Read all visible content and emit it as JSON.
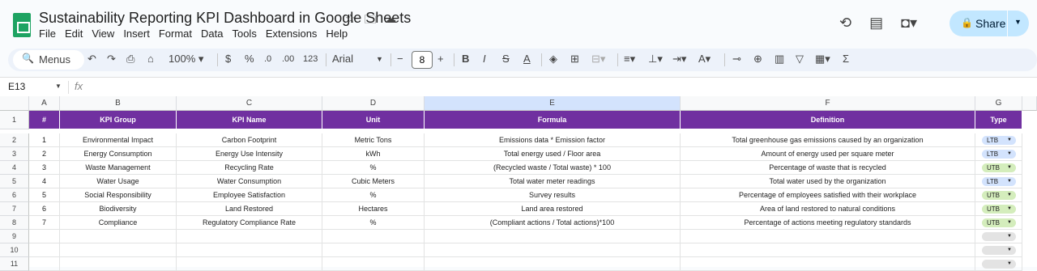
{
  "app": {
    "title": "Sustainability Reporting KPI Dashboard in Google Sheets",
    "menu": [
      "File",
      "Edit",
      "View",
      "Insert",
      "Format",
      "Data",
      "Tools",
      "Extensions",
      "Help"
    ],
    "share_label": "Share"
  },
  "toolbar": {
    "search_label": "Menus",
    "zoom": "100%",
    "currency": "$",
    "percent": "%",
    "dec_less": ".0",
    "dec_more": ".00",
    "number_format": "123",
    "font_family": "Arial",
    "font_size": "8"
  },
  "formula_bar": {
    "cell_ref": "E13",
    "fx": "fx",
    "value": ""
  },
  "columns": [
    "A",
    "B",
    "C",
    "D",
    "E",
    "F",
    "G"
  ],
  "selected_column": "E",
  "row_numbers": [
    "1",
    "2",
    "3",
    "4",
    "5",
    "6",
    "7",
    "8",
    "9",
    "10",
    "11"
  ],
  "table": {
    "headers": [
      "#",
      "KPI Group",
      "KPI Name",
      "Unit",
      "Formula",
      "Definition",
      "Type"
    ],
    "rows": [
      [
        "1",
        "Environmental Impact",
        "Carbon Footprint",
        "Metric Tons",
        "Emissions data * Emission factor",
        "Total greenhouse gas emissions caused by an organization",
        "LTB"
      ],
      [
        "2",
        "Energy Consumption",
        "Energy Use Intensity",
        "kWh",
        "Total energy used / Floor area",
        "Amount of energy used per square meter",
        "LTB"
      ],
      [
        "3",
        "Waste Management",
        "Recycling Rate",
        "%",
        "(Recycled waste / Total waste) * 100",
        "Percentage of waste that is recycled",
        "UTB"
      ],
      [
        "4",
        "Water Usage",
        "Water Consumption",
        "Cubic Meters",
        "Total water meter readings",
        "Total water used by the organization",
        "LTB"
      ],
      [
        "5",
        "Social Responsibility",
        "Employee Satisfaction",
        "%",
        "Survey results",
        "Percentage of employees satisfied with their workplace",
        "UTB"
      ],
      [
        "6",
        "Biodiversity",
        "Land Restored",
        "Hectares",
        "Land area restored",
        "Area of land restored to natural conditions",
        "UTB"
      ],
      [
        "7",
        "Compliance",
        "Regulatory Compliance Rate",
        "%",
        "(Compliant actions / Total actions)*100",
        "Percentage of actions meeting regulatory standards",
        "UTB"
      ]
    ]
  },
  "chip_colors": {
    "LTB": "#d3e3fd",
    "UTB": "#d4edbc",
    "empty": "#e3e3e3"
  },
  "colors": {
    "header_bg": "#7030a0",
    "share_bg": "#c2e7ff",
    "logo": "#1ea362"
  }
}
